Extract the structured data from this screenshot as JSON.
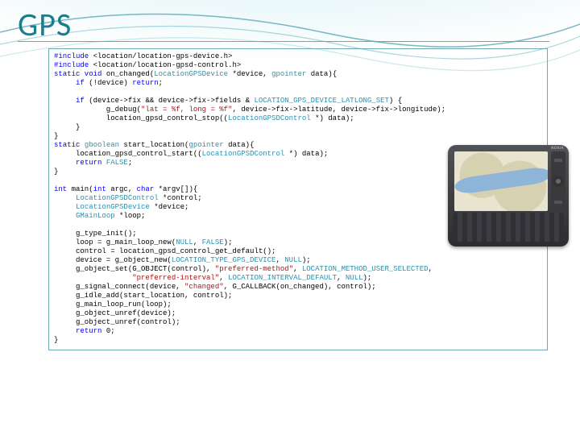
{
  "title": "GPS",
  "device_brand": "NOKIA",
  "code_lines": [
    [
      [
        "kw",
        "#include"
      ],
      [
        "",
        " <location/location-gps-device.h>"
      ]
    ],
    [
      [
        "kw",
        "#include"
      ],
      [
        "",
        " <location/location-gpsd-control.h>"
      ]
    ],
    [
      [
        "kw",
        "static void"
      ],
      [
        "",
        " on_changed("
      ],
      [
        "typ",
        "LocationGPSDevice"
      ],
      [
        "",
        " *device, "
      ],
      [
        "typ",
        "gpointer"
      ],
      [
        "",
        " data){"
      ]
    ],
    [
      [
        "",
        "     "
      ],
      [
        "kw",
        "if"
      ],
      [
        "",
        " (!device) "
      ],
      [
        "kw",
        "return"
      ],
      [
        "",
        ";"
      ]
    ],
    [
      [
        "",
        ""
      ]
    ],
    [
      [
        "",
        "     "
      ],
      [
        "kw",
        "if"
      ],
      [
        "",
        " (device->fix && device->fix->fields & "
      ],
      [
        "typ",
        "LOCATION_GPS_DEVICE_LATLONG_SET"
      ],
      [
        "",
        ") {"
      ]
    ],
    [
      [
        "",
        "            g_debug("
      ],
      [
        "str",
        "\"lat = %f, long = %f\""
      ],
      [
        "",
        ", device->fix->latitude, device->fix->longitude);"
      ]
    ],
    [
      [
        "",
        "            location_gpsd_control_stop(("
      ],
      [
        "typ",
        "LocationGPSDControl"
      ],
      [
        "",
        " *) data);"
      ]
    ],
    [
      [
        "",
        "     }"
      ]
    ],
    [
      [
        "",
        "}"
      ]
    ],
    [
      [
        "kw",
        "static"
      ],
      [
        "",
        " "
      ],
      [
        "typ",
        "gboolean"
      ],
      [
        "",
        " start_location("
      ],
      [
        "typ",
        "gpointer"
      ],
      [
        "",
        " data){"
      ]
    ],
    [
      [
        "",
        "     location_gpsd_control_start(("
      ],
      [
        "typ",
        "LocationGPSDControl"
      ],
      [
        "",
        " *) data);"
      ]
    ],
    [
      [
        "",
        "     "
      ],
      [
        "kw",
        "return"
      ],
      [
        "",
        " "
      ],
      [
        "typ",
        "FALSE"
      ],
      [
        "",
        ";"
      ]
    ],
    [
      [
        "",
        "}"
      ]
    ],
    [
      [
        "",
        ""
      ]
    ],
    [
      [
        "kw",
        "int"
      ],
      [
        "",
        " main("
      ],
      [
        "kw",
        "int"
      ],
      [
        "",
        " argc, "
      ],
      [
        "kw",
        "char"
      ],
      [
        "",
        " *argv[]){"
      ]
    ],
    [
      [
        "",
        "     "
      ],
      [
        "typ",
        "LocationGPSDControl"
      ],
      [
        "",
        " *control;"
      ]
    ],
    [
      [
        "",
        "     "
      ],
      [
        "typ",
        "LocationGPSDevice"
      ],
      [
        "",
        " *device;"
      ]
    ],
    [
      [
        "",
        "     "
      ],
      [
        "typ",
        "GMainLoop"
      ],
      [
        "",
        " *loop;"
      ]
    ],
    [
      [
        "",
        ""
      ]
    ],
    [
      [
        "",
        "     g_type_init();"
      ]
    ],
    [
      [
        "",
        "     loop = g_main_loop_new("
      ],
      [
        "typ",
        "NULL"
      ],
      [
        "",
        ", "
      ],
      [
        "typ",
        "FALSE"
      ],
      [
        "",
        ");"
      ]
    ],
    [
      [
        "",
        "     control = location_gpsd_control_get_default();"
      ]
    ],
    [
      [
        "",
        "     device = g_object_new("
      ],
      [
        "typ",
        "LOCATION_TYPE_GPS_DEVICE"
      ],
      [
        "",
        ", "
      ],
      [
        "typ",
        "NULL"
      ],
      [
        "",
        ");"
      ]
    ],
    [
      [
        "",
        "     g_object_set(G_OBJECT(control), "
      ],
      [
        "str",
        "\"preferred-method\""
      ],
      [
        "",
        ", "
      ],
      [
        "typ",
        "LOCATION_METHOD_USER_SELECTED"
      ],
      [
        "",
        ","
      ]
    ],
    [
      [
        "",
        "                  "
      ],
      [
        "str",
        "\"preferred-interval\""
      ],
      [
        "",
        ", "
      ],
      [
        "typ",
        "LOCATION_INTERVAL_DEFAULT"
      ],
      [
        "",
        ", "
      ],
      [
        "typ",
        "NULL"
      ],
      [
        "",
        ");"
      ]
    ],
    [
      [
        "",
        "     g_signal_connect(device, "
      ],
      [
        "str",
        "\"changed\""
      ],
      [
        "",
        ", G_CALLBACK(on_changed), control);"
      ]
    ],
    [
      [
        "",
        "     g_idle_add(start_location, control);"
      ]
    ],
    [
      [
        "",
        "     g_main_loop_run(loop);"
      ]
    ],
    [
      [
        "",
        "     g_object_unref(device);"
      ]
    ],
    [
      [
        "",
        "     g_object_unref(control);"
      ]
    ],
    [
      [
        "",
        "     "
      ],
      [
        "kw",
        "return"
      ],
      [
        "",
        " 0;"
      ]
    ],
    [
      [
        "",
        "}"
      ]
    ]
  ]
}
